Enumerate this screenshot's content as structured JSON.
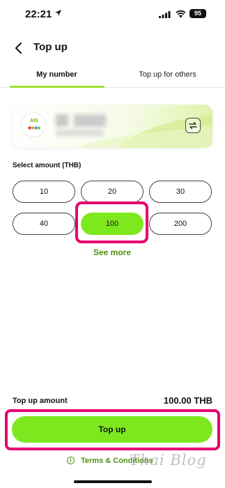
{
  "status_bar": {
    "time": "22:21",
    "battery": "95"
  },
  "header": {
    "title": "Top up"
  },
  "tabs": [
    {
      "label": "My number",
      "active": true
    },
    {
      "label": "Top up for others",
      "active": false
    }
  ],
  "card": {
    "logo_text": "AIS",
    "icons": {
      "switch": "switch-number-icon",
      "logo": "ais-logo"
    }
  },
  "amounts": {
    "label": "Select amount (THB)",
    "options": [
      "10",
      "20",
      "30",
      "40",
      "100",
      "200"
    ],
    "selected": "100",
    "see_more": "See more"
  },
  "summary": {
    "label": "Top up amount",
    "value": "100.00 THB"
  },
  "cta": {
    "label": "Top up"
  },
  "terms": {
    "label": "Terms & Conditions"
  },
  "watermark": "Thai Blog",
  "colors": {
    "accent": "#7ee81f",
    "accent_text": "#4f8f12",
    "highlight": "#e6006f"
  }
}
